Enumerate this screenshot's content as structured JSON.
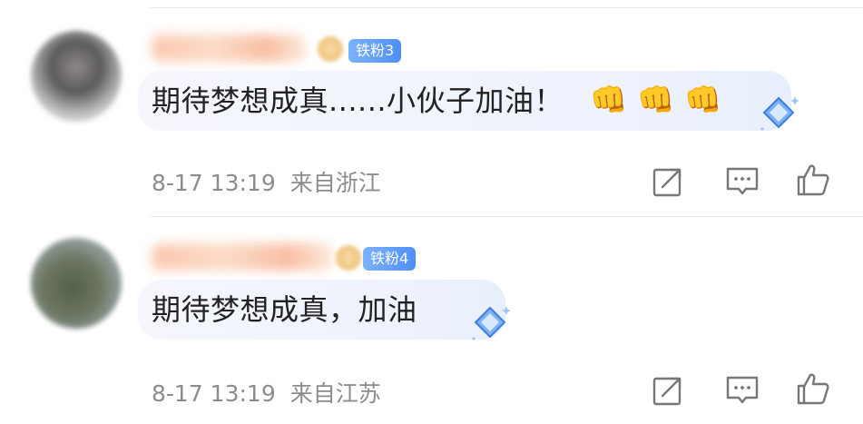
{
  "comments": [
    {
      "fan_badge": "铁粉3",
      "text": "期待梦想成真......小伙子加油！",
      "emojis": [
        "👊",
        "👊",
        "👊"
      ],
      "time": "8-17 13:19",
      "location": "来自浙江"
    },
    {
      "fan_badge": "铁粉4",
      "text": "期待梦想成真，加油",
      "time": "8-17 13:19",
      "location": "来自江苏"
    }
  ],
  "icons": {
    "share": "share-icon",
    "reply": "comment-icon",
    "like": "thumbs-up-icon",
    "bubble_decoration": "diamond-sparkle-icon"
  },
  "colors": {
    "badge": "#5b97f6",
    "meta_text": "#8c8c8c",
    "bubble_bg": "#eef2fc"
  }
}
